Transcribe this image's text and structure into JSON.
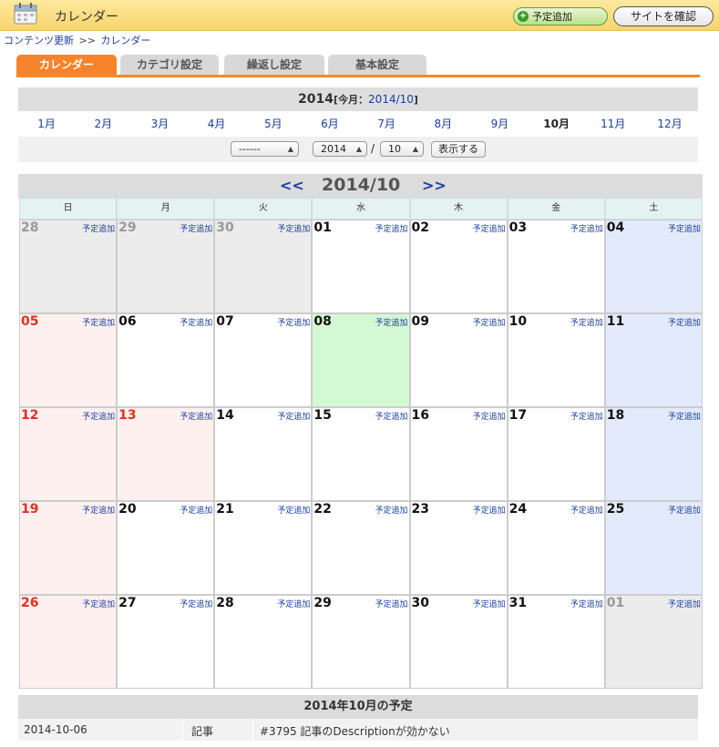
{
  "header": {
    "title": "カレンダー",
    "add_label": "予定追加",
    "site_label": "サイトを確認"
  },
  "breadcrumb": {
    "parent": "コンテンツ更新",
    "separator": ">>",
    "current": "カレンダー"
  },
  "tabs": [
    {
      "label": "カレンダー",
      "active": true
    },
    {
      "label": "カテゴリ設定",
      "active": false
    },
    {
      "label": "繰返し設定",
      "active": false
    },
    {
      "label": "基本設定",
      "active": false
    }
  ],
  "year_nav": {
    "year": "2014",
    "today_prefix": "[今月：",
    "today_link": "2014/10",
    "today_suffix": "]",
    "months": [
      "1月",
      "2月",
      "3月",
      "4月",
      "5月",
      "6月",
      "7月",
      "8月",
      "9月",
      "10月",
      "11月",
      "12月"
    ],
    "selected_month_index": 9
  },
  "controls": {
    "category_value": "------",
    "year_value": "2014",
    "separator": "/",
    "month_value": "10",
    "show_label": "表示する"
  },
  "calendar": {
    "prev": "<<",
    "next": ">>",
    "title": "2014/10",
    "weekdays": [
      "日",
      "月",
      "火",
      "水",
      "木",
      "金",
      "土"
    ],
    "add_label": "予定追加",
    "weeks": [
      [
        {
          "d": "28",
          "t": "out"
        },
        {
          "d": "29",
          "t": "out"
        },
        {
          "d": "30",
          "t": "out"
        },
        {
          "d": "01",
          "t": ""
        },
        {
          "d": "02",
          "t": ""
        },
        {
          "d": "03",
          "t": ""
        },
        {
          "d": "04",
          "t": "sat"
        }
      ],
      [
        {
          "d": "05",
          "t": "sun"
        },
        {
          "d": "06",
          "t": ""
        },
        {
          "d": "07",
          "t": ""
        },
        {
          "d": "08",
          "t": "today"
        },
        {
          "d": "09",
          "t": ""
        },
        {
          "d": "10",
          "t": ""
        },
        {
          "d": "11",
          "t": "sat"
        }
      ],
      [
        {
          "d": "12",
          "t": "sun"
        },
        {
          "d": "13",
          "t": "hol"
        },
        {
          "d": "14",
          "t": ""
        },
        {
          "d": "15",
          "t": ""
        },
        {
          "d": "16",
          "t": ""
        },
        {
          "d": "17",
          "t": ""
        },
        {
          "d": "18",
          "t": "sat"
        }
      ],
      [
        {
          "d": "19",
          "t": "sun"
        },
        {
          "d": "20",
          "t": ""
        },
        {
          "d": "21",
          "t": ""
        },
        {
          "d": "22",
          "t": ""
        },
        {
          "d": "23",
          "t": ""
        },
        {
          "d": "24",
          "t": ""
        },
        {
          "d": "25",
          "t": "sat"
        }
      ],
      [
        {
          "d": "26",
          "t": "sun"
        },
        {
          "d": "27",
          "t": ""
        },
        {
          "d": "28",
          "t": ""
        },
        {
          "d": "29",
          "t": ""
        },
        {
          "d": "30",
          "t": ""
        },
        {
          "d": "31",
          "t": ""
        },
        {
          "d": "01",
          "t": "out"
        }
      ]
    ]
  },
  "schedule": {
    "title": "2014年10月の予定",
    "rows": [
      {
        "date": "2014-10-06",
        "type": "記事",
        "title": "#3795 記事のDescriptionが効かない"
      }
    ]
  }
}
